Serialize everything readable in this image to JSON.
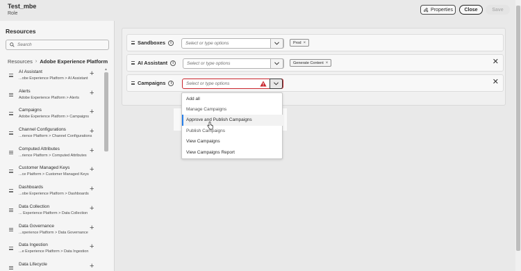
{
  "header": {
    "role_name": "Test_mbe",
    "role_label": "Role",
    "properties_label": "Properties",
    "close_label": "Close",
    "save_label": "Save"
  },
  "resources": {
    "title": "Resources",
    "search_placeholder": "Search",
    "breadcrumb": {
      "root": "Resources",
      "current": "Adobe Experience Platform"
    },
    "items": [
      {
        "name": "AI Assistant",
        "path": "...obe Experience Platform > AI Assistant"
      },
      {
        "name": "Alerts",
        "path": "Adobe Experience Platform > Alerts"
      },
      {
        "name": "Campaigns",
        "path": "Adobe Experience Platform > Campaigns"
      },
      {
        "name": "Channel Configurations",
        "path": "...rience Platform > Channel Configurations"
      },
      {
        "name": "Computed Attributes",
        "path": "...rience Platform > Computed Attributes"
      },
      {
        "name": "Customer Managed Keys",
        "path": "...ce Platform > Customer Managed Keys"
      },
      {
        "name": "Dashboards",
        "path": "...obe Experience Platform > Dashboards"
      },
      {
        "name": "Data Collection",
        "path": "... Experience Platform > Data Collection"
      },
      {
        "name": "Data Governance",
        "path": "...xperience Platform > Data Governance"
      },
      {
        "name": "Data Ingestion",
        "path": "...e Experience Platform > Data Ingestion"
      },
      {
        "name": "Data Lifecycle",
        "path": ""
      }
    ]
  },
  "permissions": {
    "rows": [
      {
        "label": "Sandboxes",
        "placeholder": "Select or type options",
        "tag": "Prod"
      },
      {
        "label": "AI Assistant",
        "placeholder": "Select or type options",
        "tag": "Generate Content"
      },
      {
        "label": "Campaigns",
        "placeholder": "Select or type options"
      }
    ],
    "dropdown_options": [
      "Add all",
      "Manage Campaigns",
      "Approve and Publish Campaigns",
      "Publish Campaigns",
      "View Campaigns",
      "View Campaigns Report"
    ]
  },
  "colors": {
    "accent": "#2680eb",
    "error": "#c9252d"
  }
}
